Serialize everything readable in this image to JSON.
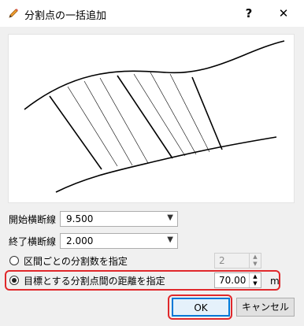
{
  "window": {
    "title": "分割点の一括追加",
    "help": "?",
    "close": "✕"
  },
  "fields": {
    "start_label": "開始横断線",
    "start_value": "9.500",
    "end_label": "終了横断線",
    "end_value": "2.000"
  },
  "options": {
    "by_count_label": "区間ごとの分割数を指定",
    "by_count_value": "2",
    "by_distance_label": "目標とする分割点間の距離を指定",
    "by_distance_value": "70.00",
    "unit": "m",
    "selected": "by_distance"
  },
  "buttons": {
    "ok": "OK",
    "cancel": "キャンセル"
  },
  "colors": {
    "highlight": "#e0282b",
    "focus": "#0078d7"
  }
}
